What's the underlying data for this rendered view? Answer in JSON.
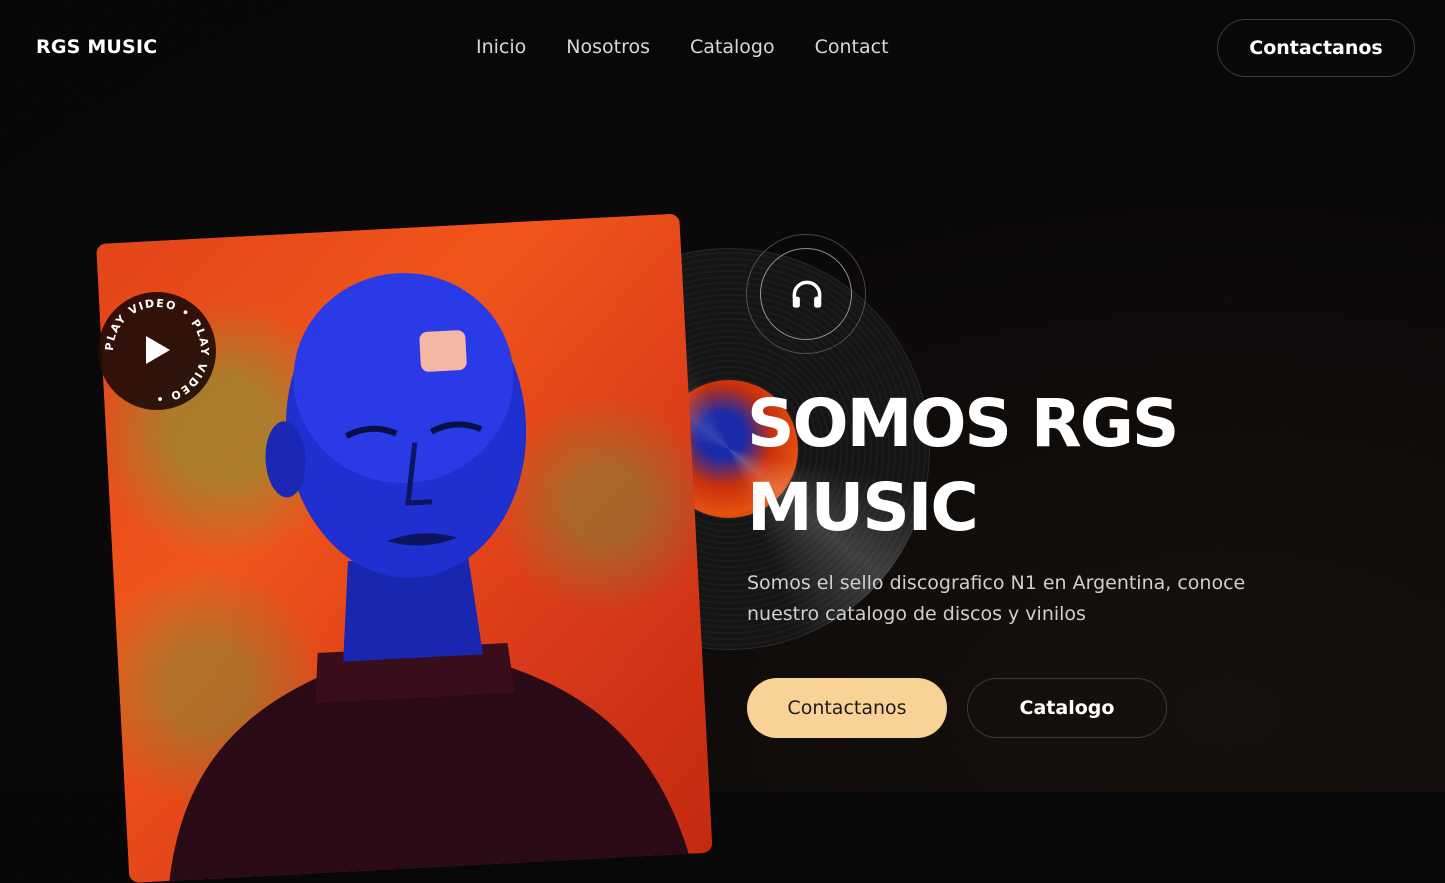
{
  "header": {
    "brand": "RGS MUSIC",
    "nav": [
      "Inicio",
      "Nosotros",
      "Catalogo",
      "Contact"
    ],
    "cta_label": "Contactanos"
  },
  "hero": {
    "title": "SOMOS RGS MUSIC",
    "subtitle": "Somos el sello discografico N1 en Argentina, conoce nuestro catalogo de discos y vinilos",
    "primary_button": "Contactanos",
    "secondary_button": "Catalogo",
    "play_badge_text": "PLAY VIDEO • PLAY VIDEO •"
  },
  "icons": {
    "play": "play-icon",
    "headphones": "headphones-icon"
  },
  "colors": {
    "background": "#0a0808",
    "accent": "#f9d396",
    "cover_orange": "#e2451a",
    "face_blue": "#1f2fd0"
  }
}
